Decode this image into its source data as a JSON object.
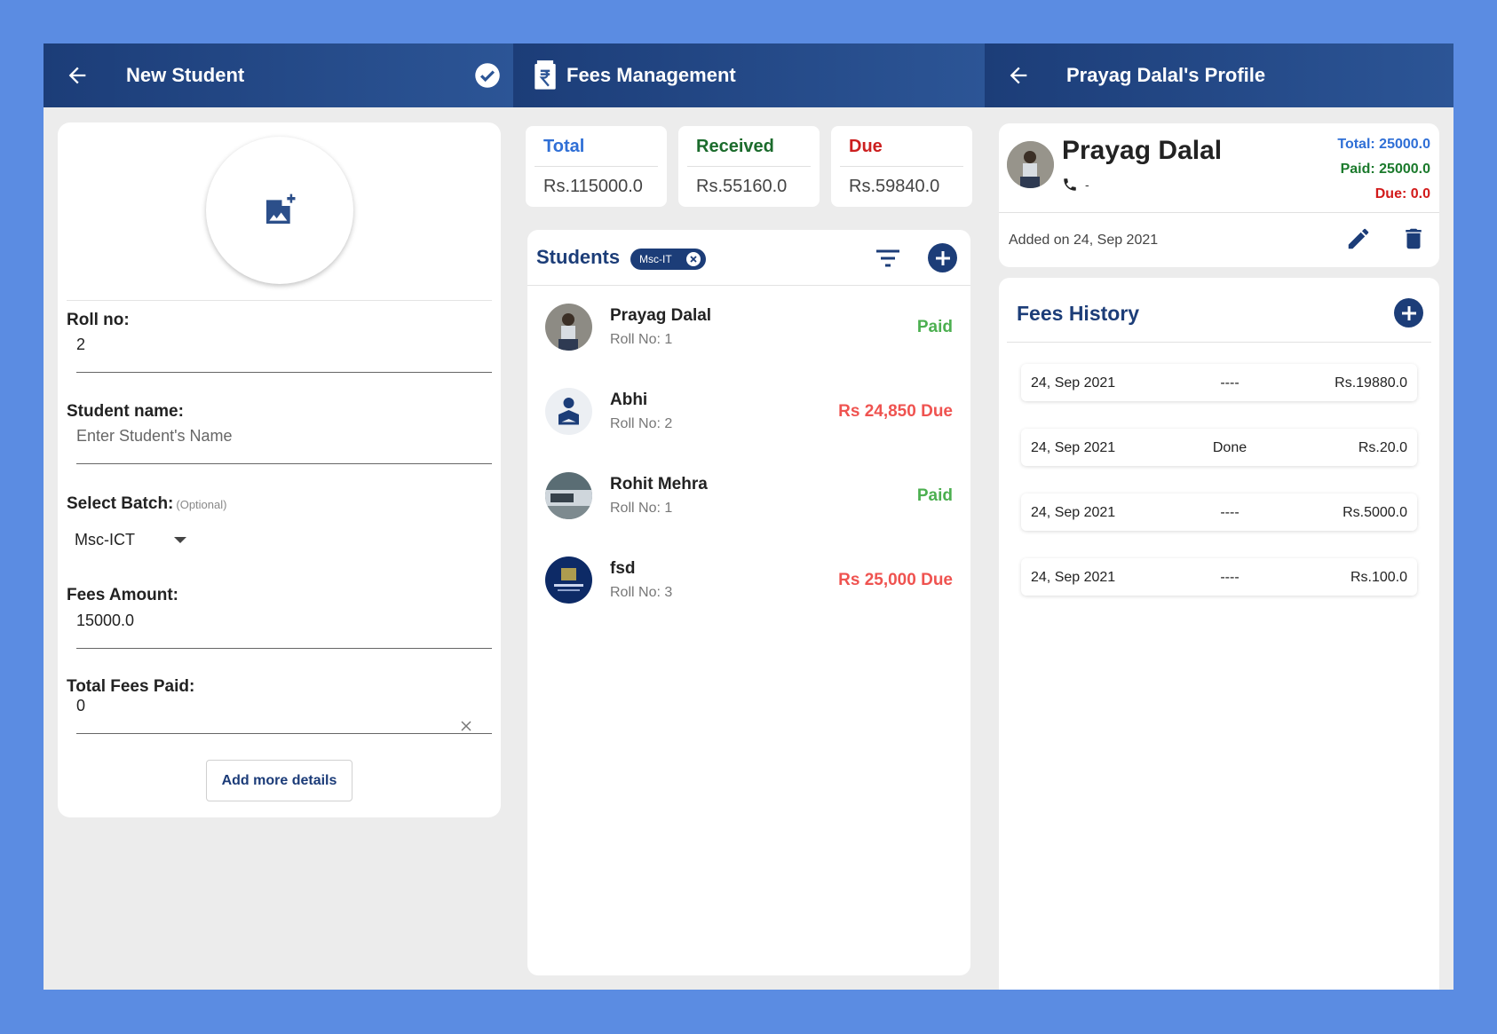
{
  "new_student": {
    "title": "New Student",
    "roll_label": "Roll no:",
    "roll_value": "2",
    "name_label": "Student name:",
    "name_placeholder": "Enter Student's Name",
    "batch_label": "Select Batch:",
    "batch_optional": "(Optional)",
    "batch_value": "Msc-ICT",
    "fees_label": "Fees Amount:",
    "fees_value": "15000.0",
    "paid_label": "Total Fees Paid:",
    "paid_value": "0",
    "add_more_label": "Add more details"
  },
  "fees_management": {
    "title": "Fees Management",
    "stats": [
      {
        "label": "Total",
        "amount": "Rs.115000.0",
        "color": "#2f6fd6"
      },
      {
        "label": "Received",
        "amount": "Rs.55160.0",
        "color": "#1b6b2c"
      },
      {
        "label": "Due",
        "amount": "Rs.59840.0",
        "color": "#cc1f1f"
      }
    ],
    "students_title": "Students",
    "filter_chip": "Msc-IT",
    "students": [
      {
        "name": "Prayag Dalal",
        "roll": "Roll No: 1",
        "status": "Paid",
        "status_color": "#4caf50",
        "avatar": "photo"
      },
      {
        "name": "Abhi",
        "roll": "Roll No: 2",
        "status": "Rs 24,850 Due",
        "status_color": "#ef5350",
        "avatar": "person-reading-icon"
      },
      {
        "name": "Rohit Mehra",
        "roll": "Roll No: 1",
        "status": "Paid",
        "status_color": "#4caf50",
        "avatar": "photo"
      },
      {
        "name": "fsd",
        "roll": "Roll No: 3",
        "status": "Rs 25,000 Due",
        "status_color": "#ef5350",
        "avatar": "logo"
      }
    ]
  },
  "profile": {
    "title": "Prayag Dalal's Profile",
    "name": "Prayag Dalal",
    "phone": "-",
    "total": "Total: 25000.0",
    "paid": "Paid: 25000.0",
    "due": "Due: 0.0",
    "added_on": "Added on 24, Sep 2021",
    "history_title": "Fees History",
    "history": [
      {
        "date": "24, Sep 2021",
        "status": "----",
        "amount": "Rs.19880.0"
      },
      {
        "date": "24, Sep 2021",
        "status": "Done",
        "amount": "Rs.20.0"
      },
      {
        "date": "24, Sep 2021",
        "status": "----",
        "amount": "Rs.5000.0"
      },
      {
        "date": "24, Sep 2021",
        "status": "----",
        "amount": "Rs.100.0"
      }
    ]
  },
  "colors": {
    "appbar": "#1c3d78",
    "background": "#5b8ce2",
    "paid_green": "#4caf50",
    "due_red": "#ef5350"
  }
}
